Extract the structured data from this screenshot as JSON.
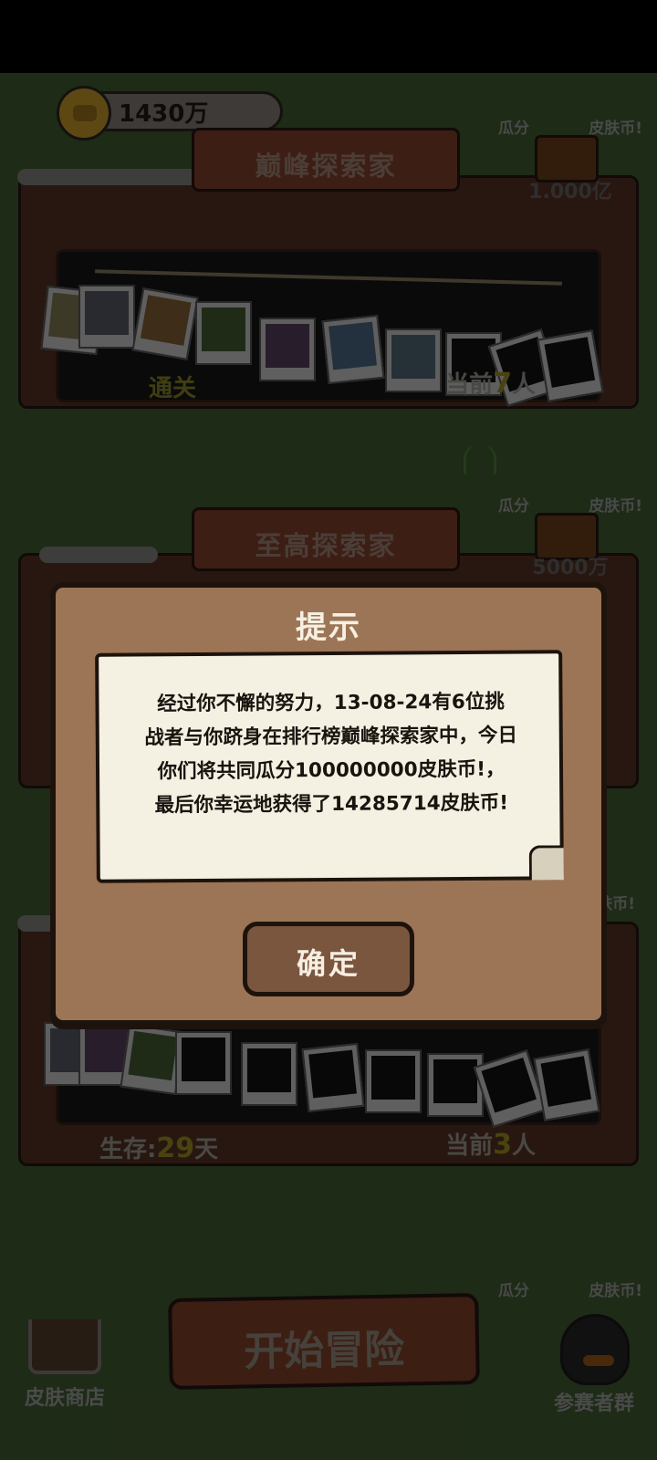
{
  "header": {
    "coin_balance": "1430万"
  },
  "panels": [
    {
      "banner_title": "巅峰探索家",
      "chest_prefix": "瓜分",
      "chest_suffix": "皮肤币!",
      "chest_amount": "1.000亿",
      "footer_left": "通关",
      "footer_right_prefix": "当前",
      "footer_right_count": "7",
      "footer_right_suffix": "人"
    },
    {
      "banner_title": "至高探索家",
      "chest_prefix": "瓜分",
      "chest_suffix": "皮肤币!",
      "chest_amount": "5000万"
    },
    {
      "chest_suffix": "皮肤币!",
      "footer_left_prefix": "生存:",
      "footer_left_count": "29",
      "footer_left_suffix": "天",
      "footer_right_prefix": "当前",
      "footer_right_count": "3",
      "footer_right_suffix": "人"
    },
    {
      "chest_prefix": "瓜分",
      "chest_suffix": "皮肤币!"
    }
  ],
  "bottom_bar": {
    "shop_label": "皮肤商店",
    "start_label": "开始冒险",
    "group_label": "参赛者群"
  },
  "dialog": {
    "title": "提示",
    "lines": [
      "经过你不懈的努力，13-08-24有6位挑",
      "战者与你跻身在排行榜巅峰探索家中，今日",
      "你们将共同瓜分100000000皮肤币!，",
      "最后你幸运地获得了14285714皮肤币!"
    ],
    "confirm_label": "确定"
  }
}
